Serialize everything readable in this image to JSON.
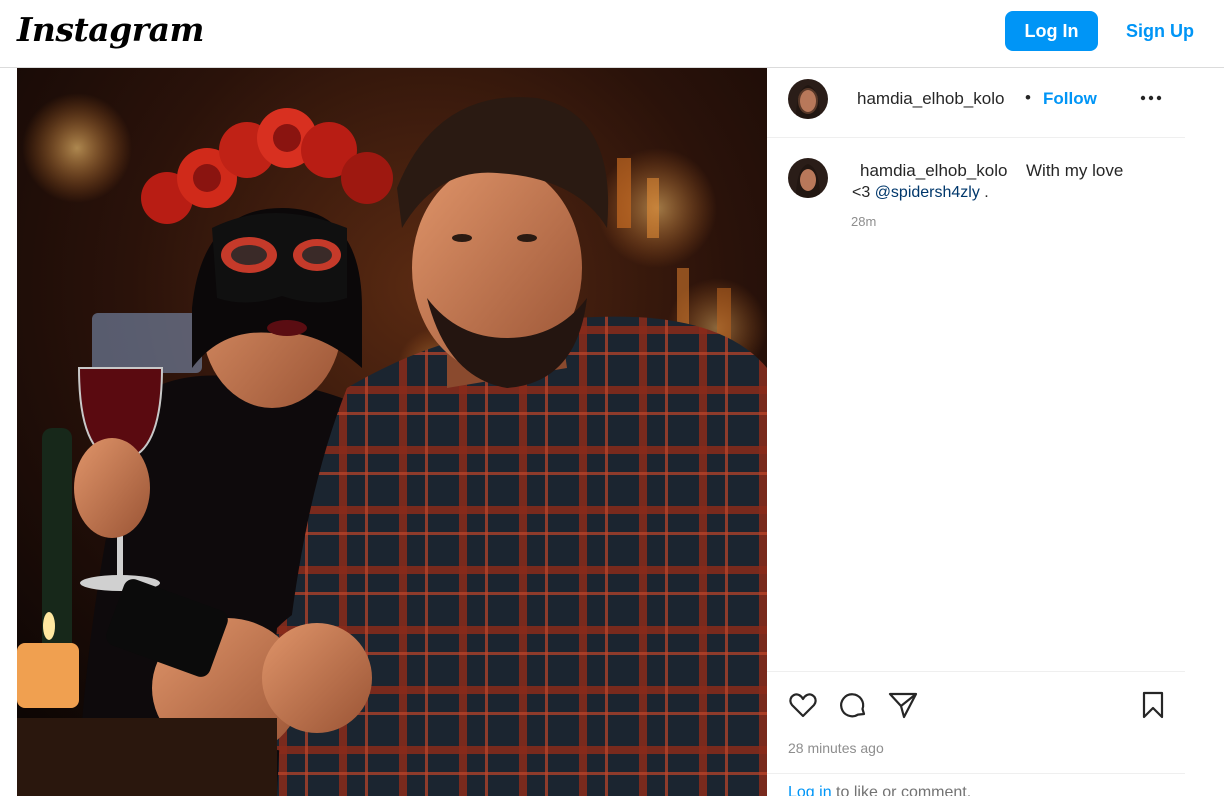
{
  "nav": {
    "logo_text": "Instagram",
    "login_label": "Log In",
    "signup_label": "Sign Up"
  },
  "post": {
    "username": "hamdia_elhob_kolo",
    "dot": "•",
    "follow_label": "Follow",
    "caption": {
      "username": "hamdia_elhob_kolo",
      "text": "With my love",
      "line2_prefix": "<3 ",
      "mention": "@spidersh4zly",
      "line2_suffix": " .",
      "time": "28m"
    },
    "time_ago": "28 minutes ago",
    "login_prompt": {
      "link": "Log in",
      "rest": " to like or comment."
    }
  },
  "icons": {
    "like": "heart-icon",
    "comment": "comment-icon",
    "share": "share-icon",
    "save": "bookmark-icon",
    "more": "more-options-icon"
  },
  "colors": {
    "accent": "#0095f6",
    "mention": "#00376b",
    "muted": "#8e8e8e"
  }
}
